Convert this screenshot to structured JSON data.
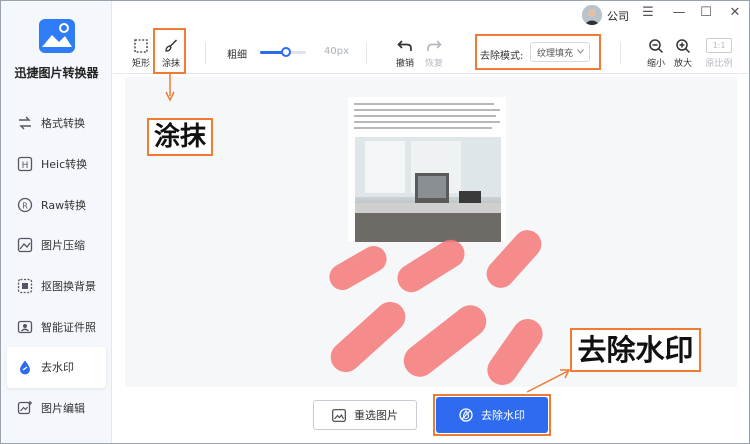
{
  "app": {
    "title": "迅捷图片转换器"
  },
  "sidebar": {
    "items": [
      {
        "label": "格式转换",
        "icon": "format-convert-icon"
      },
      {
        "label": "Heic转换",
        "icon": "heic-icon"
      },
      {
        "label": "Raw转换",
        "icon": "raw-icon"
      },
      {
        "label": "图片压缩",
        "icon": "compress-icon"
      },
      {
        "label": "抠图换背景",
        "icon": "cutout-icon"
      },
      {
        "label": "智能证件照",
        "icon": "id-photo-icon"
      },
      {
        "label": "去水印",
        "icon": "watermark-icon"
      },
      {
        "label": "图片编辑",
        "icon": "edit-icon"
      }
    ]
  },
  "titlebar": {
    "user_label": "公司",
    "menu": "☰",
    "minimize": "—",
    "maximize": "☐",
    "close": "✕"
  },
  "toolbar": {
    "rect_label": "矩形",
    "smear_label": "涂抹",
    "thickness_label": "粗细",
    "thickness_value": "40px",
    "undo_label": "撤销",
    "redo_label": "恢复",
    "mode_label": "去除模式:",
    "mode_value": "纹理填充",
    "zoom_out_label": "缩小",
    "zoom_in_label": "放大",
    "fit_badge": "1:1",
    "original_label": "原比例"
  },
  "bottom": {
    "reselect_label": "重选图片",
    "remove_label": "去除水印"
  },
  "annotations": {
    "smear": "涂抹",
    "remove": "去除水印"
  },
  "colors": {
    "accent": "#2f6bf0",
    "highlight": "#f07c34",
    "mask": "#f47878"
  }
}
